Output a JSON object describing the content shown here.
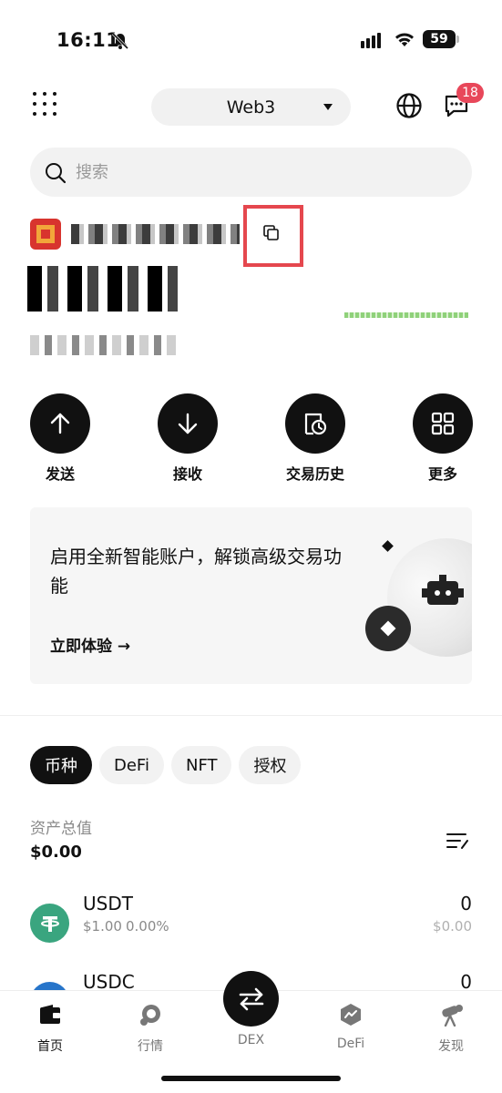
{
  "status_bar": {
    "time": "16:11",
    "battery": "59"
  },
  "header": {
    "network": "Web3",
    "message_count": "18"
  },
  "search": {
    "placeholder": "搜索"
  },
  "actions": [
    {
      "label": "发送",
      "icon": "arrow-up-icon"
    },
    {
      "label": "接收",
      "icon": "arrow-down-icon"
    },
    {
      "label": "交易历史",
      "icon": "history-icon"
    },
    {
      "label": "更多",
      "icon": "grid-icon"
    }
  ],
  "promo": {
    "title": "启用全新智能账户，解锁高级交易功能",
    "cta": "立即体验 →"
  },
  "tabs": [
    "币种",
    "DeFi",
    "NFT",
    "授权"
  ],
  "assets": {
    "total_label": "资产总值",
    "total_value": "$0.00"
  },
  "tokens": [
    {
      "symbol": "USDT",
      "price": "$1.00",
      "change": "0.00%",
      "amount": "0",
      "value": "$0.00",
      "color": "#3aa57f"
    },
    {
      "symbol": "USDC",
      "price": "",
      "change": "",
      "amount": "0",
      "value": "",
      "color": "#2775ca"
    }
  ],
  "nav": {
    "home": "首页",
    "market": "行情",
    "dex": "DEX",
    "defi": "DeFi",
    "discover": "发现"
  },
  "colors": {
    "accent": "#111111",
    "highlight": "#e5474e",
    "badge": "#e8475a",
    "usdt": "#3aa57f"
  }
}
